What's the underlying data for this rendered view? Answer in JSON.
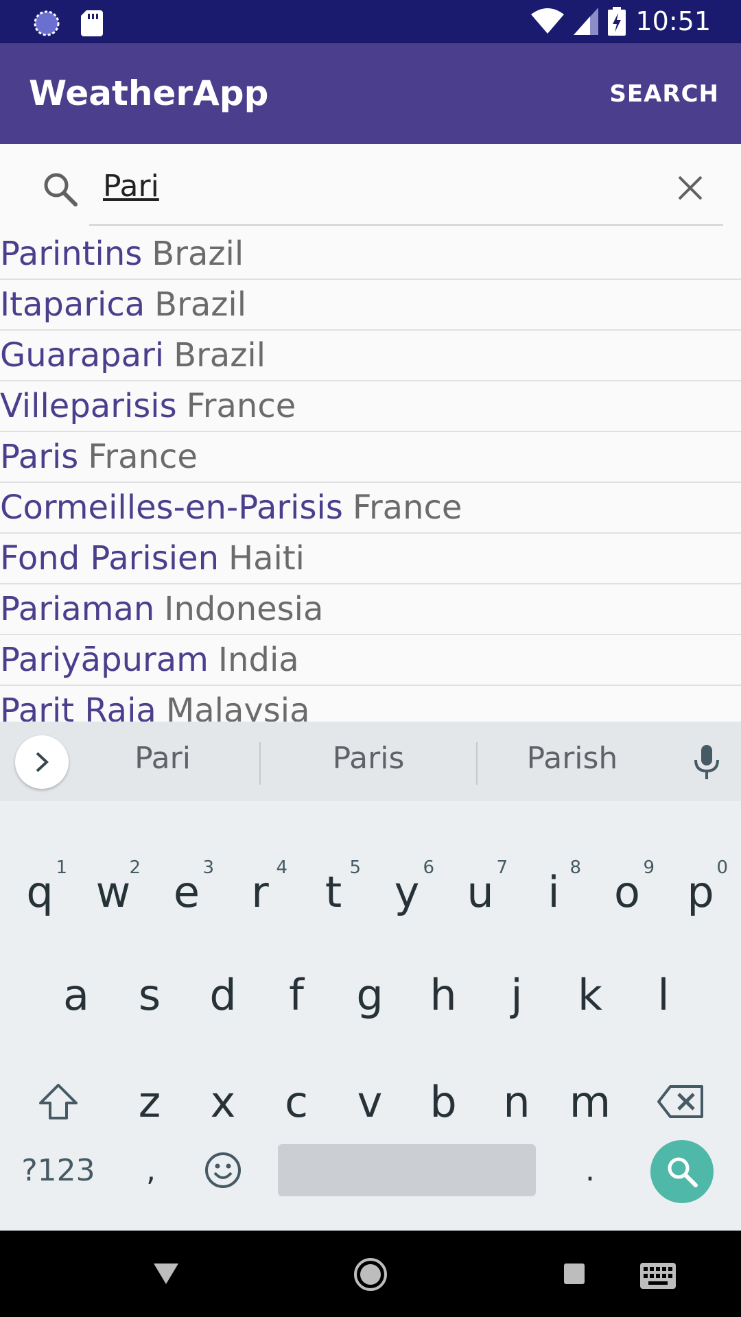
{
  "status_bar": {
    "time": "10:51"
  },
  "app_bar": {
    "title": "WeatherApp",
    "action_label": "SEARCH"
  },
  "search": {
    "query": "Pari"
  },
  "results": [
    {
      "city": "Parintins",
      "country": "Brazil"
    },
    {
      "city": "Itaparica",
      "country": "Brazil"
    },
    {
      "city": "Guarapari",
      "country": "Brazil"
    },
    {
      "city": "Villeparisis",
      "country": "France"
    },
    {
      "city": "Paris",
      "country": "France"
    },
    {
      "city": "Cormeilles-en-Parisis",
      "country": "France"
    },
    {
      "city": "Fond Parisien",
      "country": "Haiti"
    },
    {
      "city": "Pariaman",
      "country": "Indonesia"
    },
    {
      "city": "Pariyāpuram",
      "country": "India"
    },
    {
      "city": "Parit Raja",
      "country": "Malaysia"
    }
  ],
  "keyboard": {
    "suggestions": [
      "Pari",
      "Paris",
      "Parish"
    ],
    "row1": [
      "q",
      "w",
      "e",
      "r",
      "t",
      "y",
      "u",
      "i",
      "o",
      "p"
    ],
    "row1_hints": [
      "1",
      "2",
      "3",
      "4",
      "5",
      "6",
      "7",
      "8",
      "9",
      "0"
    ],
    "row2": [
      "a",
      "s",
      "d",
      "f",
      "g",
      "h",
      "j",
      "k",
      "l"
    ],
    "row3": [
      "z",
      "x",
      "c",
      "v",
      "b",
      "n",
      "m"
    ],
    "symbols_label": "?123",
    "comma": ",",
    "period": "."
  },
  "colors": {
    "status_bar": "#1a1a6e",
    "app_bar": "#4b3e8c",
    "accent_key": "#4fb8a8"
  },
  "icons": [
    "search-icon",
    "clear-icon",
    "mic-icon",
    "shift-icon",
    "backspace-icon",
    "emoji-icon",
    "back-nav-icon",
    "home-nav-icon",
    "recents-nav-icon",
    "keyboard-switch-icon"
  ]
}
